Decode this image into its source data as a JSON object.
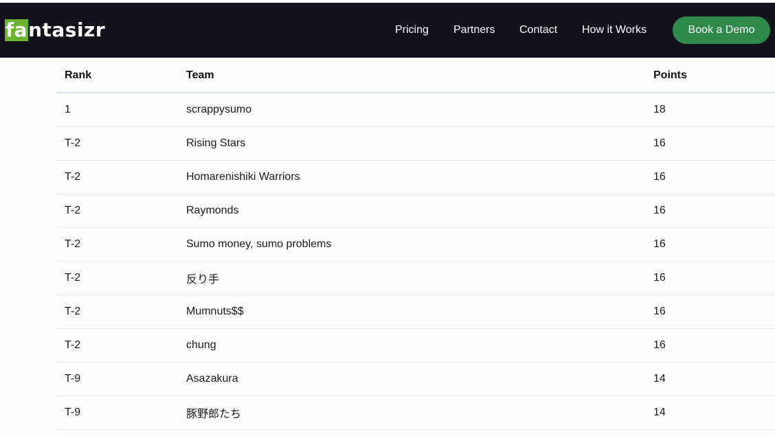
{
  "brand": {
    "logo_highlight": "fa",
    "logo_rest": "ntasizr",
    "highlight_color": "#6bb432",
    "navbar_color": "#12121c"
  },
  "nav": {
    "pricing": "Pricing",
    "partners": "Partners",
    "contact": "Contact",
    "how_it_works": "How it Works",
    "book_demo": "Book a Demo",
    "book_demo_color": "#2f8a4e"
  },
  "table": {
    "headers": {
      "rank": "Rank",
      "team": "Team",
      "points": "Points"
    },
    "rows": [
      {
        "rank": "1",
        "team": "scrappysumo",
        "points": "18"
      },
      {
        "rank": "T-2",
        "team": "Rising Stars",
        "points": "16"
      },
      {
        "rank": "T-2",
        "team": "Homarenishiki Warriors",
        "points": "16"
      },
      {
        "rank": "T-2",
        "team": "Raymonds",
        "points": "16"
      },
      {
        "rank": "T-2",
        "team": "Sumo money, sumo problems",
        "points": "16"
      },
      {
        "rank": "T-2",
        "team": "反り手",
        "points": "16"
      },
      {
        "rank": "T-2",
        "team": "Mumnuts$$",
        "points": "16"
      },
      {
        "rank": "T-2",
        "team": "chung",
        "points": "16"
      },
      {
        "rank": "T-9",
        "team": "Asazakura",
        "points": "14"
      },
      {
        "rank": "T-9",
        "team": "豚野郎たち",
        "points": "14"
      }
    ]
  }
}
